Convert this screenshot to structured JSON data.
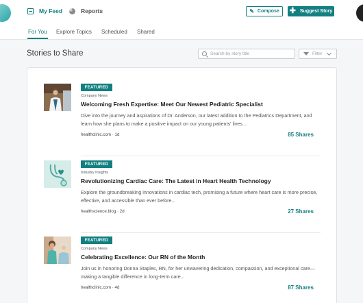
{
  "nav": {
    "my_feed": "My Feed",
    "reports": "Reports",
    "compose": "Compose",
    "suggest": "Suggest Story"
  },
  "tabs": [
    "For You",
    "Explore Topics",
    "Scheduled",
    "Shared"
  ],
  "page": {
    "title": "Stories to Share",
    "search_placeholder": "Search by story title",
    "filter": "Filter"
  },
  "stories": [
    {
      "badge": "FEATURED",
      "category": "Company News",
      "title": "Welcoming Fresh Expertise: Meet Our Newest Pediatric Specialist",
      "description": "Dive into the journey and aspirations of Dr. Anderson, our latest addition to the Pediatrics Department, and learn how she plans to make a positive impact on our young patients' lives...",
      "meta": "healthclinic.com · 1d",
      "shares": "85 Shares",
      "thumb_icon": "doctor-photo"
    },
    {
      "badge": "FEATURED",
      "category": "Industry Insights",
      "title": "Revolutionizing Cardiac Care: The Latest in Heart Health Technology",
      "description": "Explore the groundbreaking innovations in cardiac tech, promising a future where heart care is more precise, effective, and accessible than ever before...",
      "meta": "healthscience.blog · 2d",
      "shares": "27 Shares",
      "thumb_icon": "stethoscope-heart-photo"
    },
    {
      "badge": "FEATURED",
      "category": "Company News",
      "title": "Celebrating Excellence: Our RN of the Month",
      "description": "Join us in honoring Donna Staples, RN, for her unwavering dedication, compassion, and exceptional care—making a tangible difference in long-term care...",
      "meta": "healthclinic.com · 4d",
      "shares": "87 Shares",
      "thumb_icon": "nurse-patient-photo"
    }
  ],
  "colors": {
    "accent": "#127f80",
    "background": "#f5f6f7"
  }
}
